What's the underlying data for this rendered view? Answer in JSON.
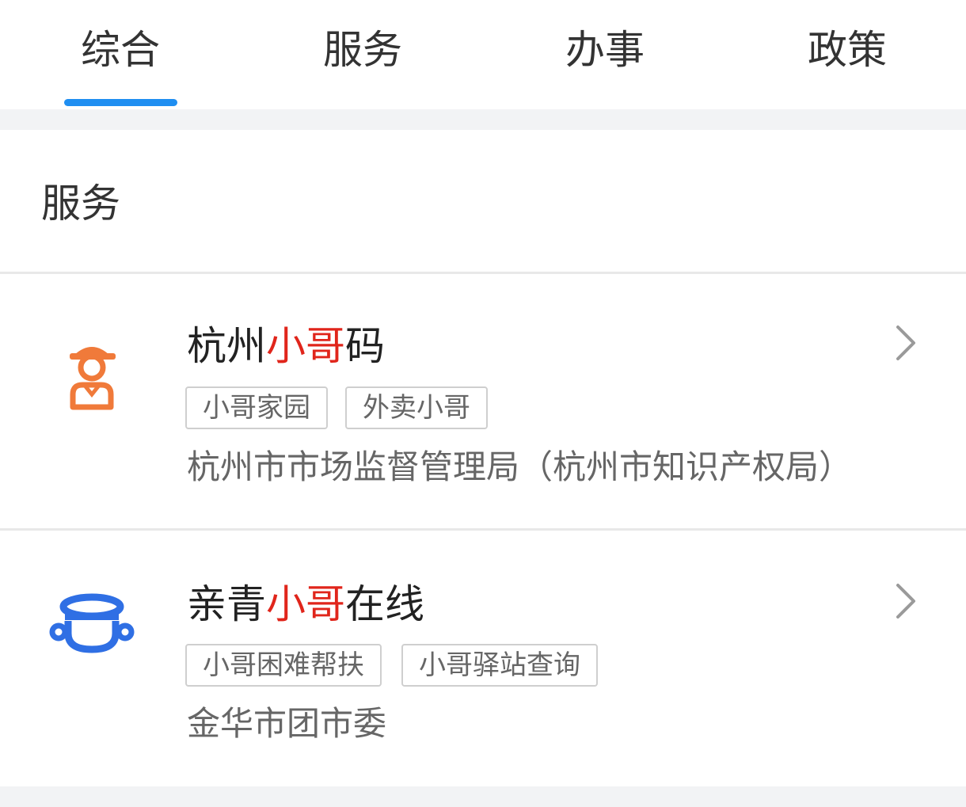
{
  "tabs": [
    {
      "label": "综合",
      "active": true
    },
    {
      "label": "服务",
      "active": false
    },
    {
      "label": "办事",
      "active": false
    },
    {
      "label": "政策",
      "active": false
    }
  ],
  "section": {
    "title": "服务"
  },
  "items": [
    {
      "title_pre": "杭州",
      "title_hl": "小哥",
      "title_post": "码",
      "tags": [
        "小哥家园",
        "外卖小哥"
      ],
      "org": "杭州市市场监督管理局（杭州市知识产权局）",
      "icon": "courier-person-icon"
    },
    {
      "title_pre": "亲青",
      "title_hl": "小哥",
      "title_post": "在线",
      "tags": [
        "小哥困难帮扶",
        "小哥驿站查询"
      ],
      "org": "金华市团市委",
      "icon": "courier-helmet-icon"
    }
  ],
  "colors": {
    "accent": "#1f8ef1",
    "highlight": "#e0251b",
    "icon_orange": "#f07a3a",
    "icon_blue": "#2f6fe4"
  }
}
